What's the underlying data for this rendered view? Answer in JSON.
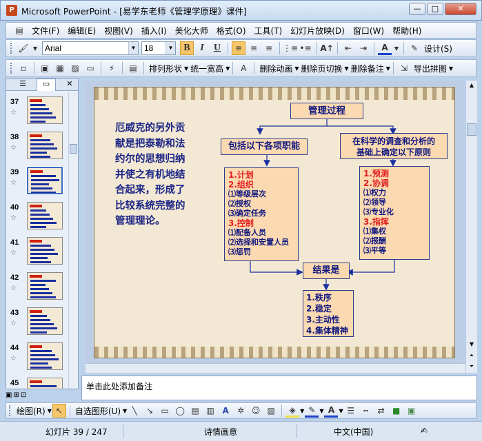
{
  "window": {
    "title": "Microsoft PowerPoint - [易学东老师《管理学原理》课件]",
    "buttons": {
      "minimize": "—",
      "maximize": "□",
      "close": "✕"
    }
  },
  "menu": [
    "文件(F)",
    "编辑(E)",
    "视图(V)",
    "插入(I)",
    "美化大师",
    "格式(O)",
    "工具(T)",
    "幻灯片放映(D)",
    "窗口(W)",
    "帮助(H)"
  ],
  "format_toolbar": {
    "font": "Arial",
    "size": "18",
    "bold": "B",
    "italic": "I",
    "underline": "U",
    "design": "设计(S)"
  },
  "extra_toolbar": {
    "arrange": "排列形状",
    "uniform_width": "统一宽高",
    "delete_anim": "删除动画",
    "delete_trans": "删除页切换",
    "delete_notes": "删除备注",
    "export": "导出拼图"
  },
  "slides": [
    {
      "num": "37",
      "star": "☆"
    },
    {
      "num": "38",
      "star": "☆"
    },
    {
      "num": "39",
      "star": "☆"
    },
    {
      "num": "40",
      "star": "☆"
    },
    {
      "num": "41",
      "star": "☆"
    },
    {
      "num": "42",
      "star": "☆"
    },
    {
      "num": "43",
      "star": "☆"
    },
    {
      "num": "44",
      "star": "☆"
    },
    {
      "num": "45",
      "star": "☆"
    }
  ],
  "slide": {
    "paragraph": "厄威克的另外贡献是把泰勒和法约尔的思想归纳并使之有机地结合起来，形成了比较系统完整的管理理论。",
    "top_box": "管理过程",
    "left_header": "包括以下各项职能",
    "right_header_1": "在科学的调查和分析的",
    "right_header_2": "基础上确定以下原则",
    "left_list": [
      {
        "text": "1.计划",
        "red": true
      },
      {
        "text": "2.组织",
        "red": true
      },
      {
        "text": "⑴等级层次",
        "red": false
      },
      {
        "text": "⑵授权",
        "red": false
      },
      {
        "text": "⑶确定任务",
        "red": false
      },
      {
        "text": "3.控制",
        "red": true
      },
      {
        "text": "⑴配备人员",
        "red": false
      },
      {
        "text": "⑵选择和安置人员",
        "red": false
      },
      {
        "text": "⑶惩罚",
        "red": false
      }
    ],
    "right_list": [
      {
        "text": "1.预测",
        "red": true
      },
      {
        "text": "2.协调",
        "red": true
      },
      {
        "text": "⑴权力",
        "red": false
      },
      {
        "text": "⑵领导",
        "red": false
      },
      {
        "text": "⑶专业化",
        "red": false
      },
      {
        "text": "3.指挥",
        "red": true
      },
      {
        "text": "⑴集权",
        "red": false
      },
      {
        "text": "⑵报酬",
        "red": false
      },
      {
        "text": "⑶平等",
        "red": false
      }
    ],
    "result_box": "结果是",
    "result_list": [
      "1.秩序",
      "2.稳定",
      "3.主动性",
      "4.集体精神"
    ]
  },
  "notes_placeholder": "单击此处添加备注",
  "draw_toolbar": {
    "draw": "绘图(R)",
    "autoshape": "自选图形(U)"
  },
  "status": {
    "slide": "幻灯片 39 / 247",
    "theme": "诗情画意",
    "lang": "中文(中国)"
  }
}
